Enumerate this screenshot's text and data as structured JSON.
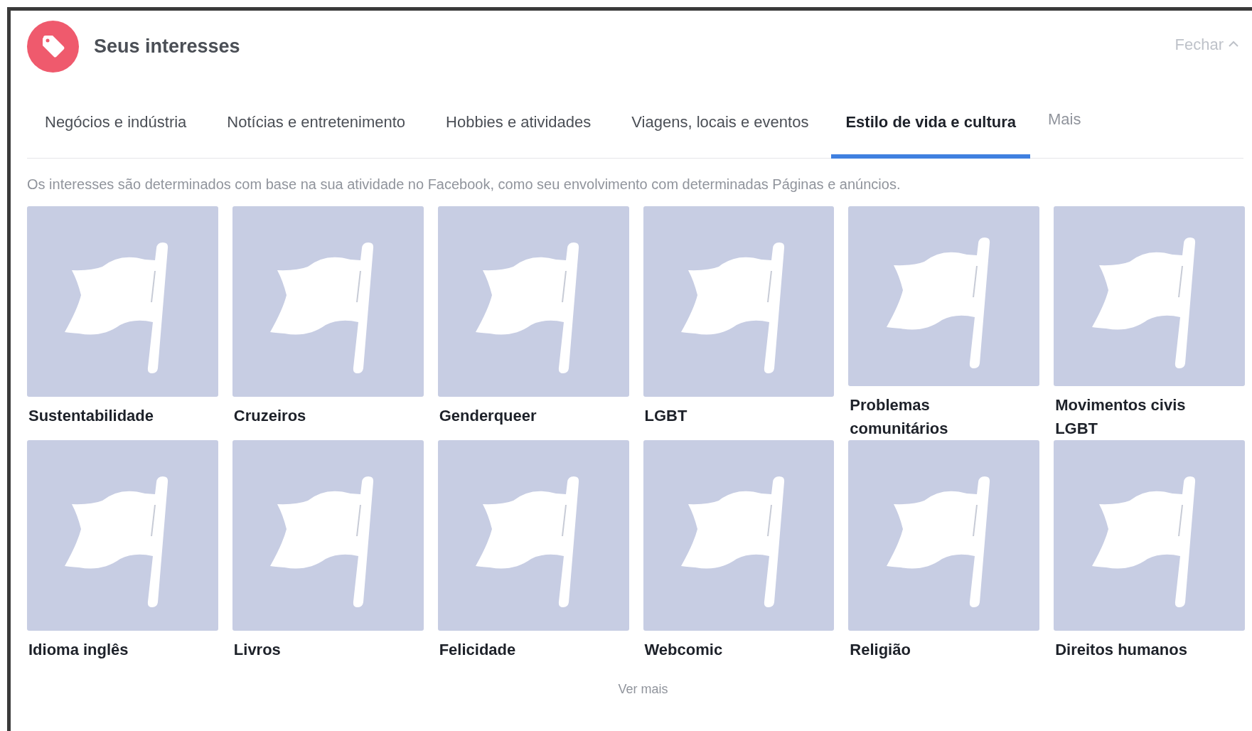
{
  "header": {
    "title": "Seus interesses",
    "close_label": "Fechar"
  },
  "tabs": [
    {
      "label": "Negócios e indústria",
      "selected": false
    },
    {
      "label": "Notícias e entretenimento",
      "selected": false
    },
    {
      "label": "Hobbies e atividades",
      "selected": false
    },
    {
      "label": "Viagens, locais e eventos",
      "selected": false
    },
    {
      "label": "Estilo de vida e cultura",
      "selected": true
    }
  ],
  "more_tab": "Mais",
  "description": "Os interesses são determinados com base na sua atividade no Facebook, como seu envolvimento com determinadas Páginas e anúncios.",
  "interests": [
    {
      "name": "Sustentabilidade"
    },
    {
      "name": "Cruzeiros"
    },
    {
      "name": "Genderqueer"
    },
    {
      "name": "LGBT"
    },
    {
      "name": "Problemas comunitários"
    },
    {
      "name": "Movimentos civis LGBT"
    },
    {
      "name": "Idioma inglês"
    },
    {
      "name": "Livros"
    },
    {
      "name": "Felicidade"
    },
    {
      "name": "Webcomic"
    },
    {
      "name": "Religião"
    },
    {
      "name": "Direitos humanos"
    }
  ],
  "see_more": "Ver mais"
}
